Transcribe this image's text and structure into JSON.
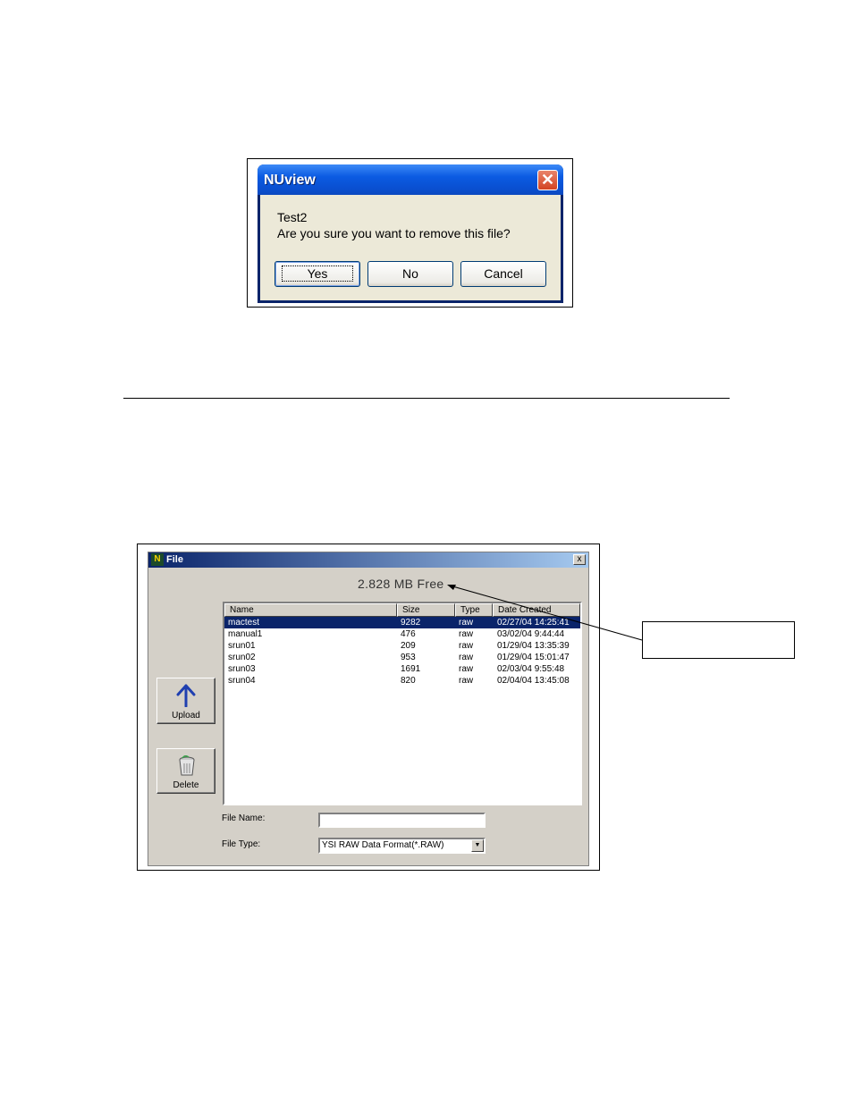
{
  "dialog": {
    "title": "NUview",
    "close_glyph": "✕",
    "file_name": "Test2",
    "message": "Are you sure you want to remove this file?",
    "buttons": {
      "yes": "Yes",
      "no": "No",
      "cancel": "Cancel"
    }
  },
  "file_window": {
    "title": "File",
    "close_glyph": "x",
    "free_space": "2.828  MB Free",
    "columns": [
      "Name",
      "Size",
      "Type",
      "Date Created"
    ],
    "files": [
      {
        "name": "mactest",
        "size": "9282",
        "type": "raw",
        "date": "02/27/04 14:25:41",
        "selected": true
      },
      {
        "name": "manual1",
        "size": "476",
        "type": "raw",
        "date": "03/02/04 9:44:44"
      },
      {
        "name": "srun01",
        "size": "209",
        "type": "raw",
        "date": "01/29/04 13:35:39"
      },
      {
        "name": "srun02",
        "size": "953",
        "type": "raw",
        "date": "01/29/04 15:01:47"
      },
      {
        "name": "srun03",
        "size": "1691",
        "type": "raw",
        "date": "02/03/04 9:55:48"
      },
      {
        "name": "srun04",
        "size": "820",
        "type": "raw",
        "date": "02/04/04 13:45:08"
      }
    ],
    "upload_label": "Upload",
    "delete_label": "Delete",
    "file_name_label": "File Name:",
    "file_name_value": "",
    "file_type_label": "File Type:",
    "file_type_value": "YSI RAW Data Format(*.RAW)",
    "icons": {
      "upload": "arrow-up-icon",
      "delete": "trash-can-icon",
      "app": "app-icon"
    }
  },
  "callout": {
    "text": ""
  },
  "colors": {
    "xp_title": "#0b5be2",
    "selection": "#0a246a",
    "face": "#d4d0c8",
    "dialog_face": "#ece9d8"
  }
}
